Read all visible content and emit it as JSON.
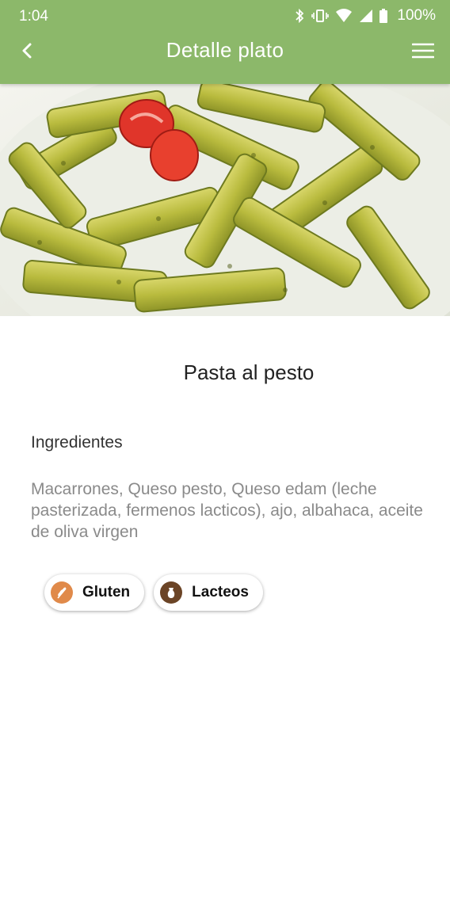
{
  "status_bar": {
    "time": "1:04",
    "battery_percent": "100%"
  },
  "toolbar": {
    "title": "Detalle plato"
  },
  "dish": {
    "name": "Pasta al pesto",
    "ingredients_label": "Ingredientes",
    "ingredients_text": "Macarrones, Queso pesto, Queso edam (leche pasterizada, fermenos lacticos), ajo, albahaca, aceite de oliva virgen"
  },
  "allergens": [
    {
      "label": "Gluten",
      "icon": "wheat-icon",
      "color": "#e08a4a"
    },
    {
      "label": "Lacteos",
      "icon": "milk-jug-icon",
      "color": "#6b4426"
    }
  ],
  "colors": {
    "appbar": "#8cb86a"
  }
}
